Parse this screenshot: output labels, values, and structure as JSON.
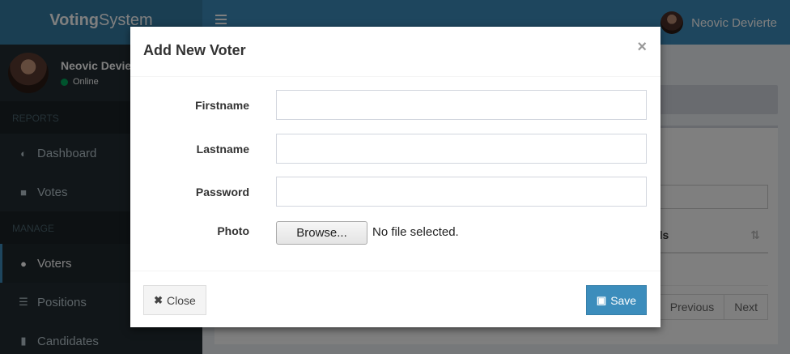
{
  "app": {
    "logo_bold": "Voting",
    "logo_rest": "System"
  },
  "topbar": {
    "user_name": "Neovic Devierte"
  },
  "sidebar": {
    "user_name": "Neovic Devierte",
    "status": "Online",
    "headers": [
      "REPORTS",
      "MANAGE"
    ],
    "items": [
      {
        "label": "Dashboard",
        "icon": "dashboard-icon"
      },
      {
        "label": "Votes",
        "icon": "lock-icon"
      },
      {
        "label": "Voters",
        "icon": "users-icon"
      },
      {
        "label": "Positions",
        "icon": "tasks-icon"
      },
      {
        "label": "Candidates",
        "icon": "badge-icon"
      }
    ]
  },
  "table": {
    "tools_header": "Tools",
    "prev_label": "Previous",
    "next_label": "Next"
  },
  "modal": {
    "title": "Add New Voter",
    "close_symbol": "×",
    "fields": {
      "firstname_label": "Firstname",
      "lastname_label": "Lastname",
      "password_label": "Password",
      "photo_label": "Photo",
      "firstname_value": "",
      "lastname_value": "",
      "password_value": ""
    },
    "browse_label": "Browse...",
    "file_status": "No file selected.",
    "close_button": "Close",
    "save_button": "Save"
  }
}
